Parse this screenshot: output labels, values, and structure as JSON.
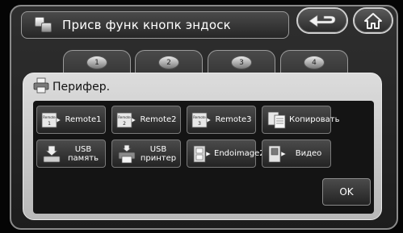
{
  "header": {
    "title": "Присв функ кнопк эндоск",
    "title_icon": "two-squares-icon",
    "back_icon": "return-arrow-icon",
    "home_icon": "home-icon"
  },
  "tabs": [
    {
      "number": "1"
    },
    {
      "number": "2"
    },
    {
      "number": "3"
    },
    {
      "number": "4"
    }
  ],
  "panel": {
    "title": "Перифер.",
    "icon": "printer-icon"
  },
  "functions": [
    {
      "label": "Remote1",
      "icon_text": "Remote",
      "icon_num": "1",
      "icon": "remote-icon"
    },
    {
      "label": "Remote2",
      "icon_text": "Remote",
      "icon_num": "2",
      "icon": "remote-icon"
    },
    {
      "label": "Remote3",
      "icon_text": "Remote",
      "icon_num": "3",
      "icon": "remote-icon"
    },
    {
      "label": "Копировать",
      "icon": "copy-icon"
    },
    {
      "label": "USB память",
      "icon": "usb-memory-icon"
    },
    {
      "label": "USB принтер",
      "icon": "usb-printer-icon"
    },
    {
      "label": "Endoimage2",
      "icon": "endoimage-icon"
    },
    {
      "label": "Видео",
      "icon": "video-icon"
    }
  ],
  "ok_label": "OK",
  "colors": {
    "background": "#050505",
    "panel": "#cfcfcf",
    "button": "#333333",
    "text": "#ffffff"
  }
}
